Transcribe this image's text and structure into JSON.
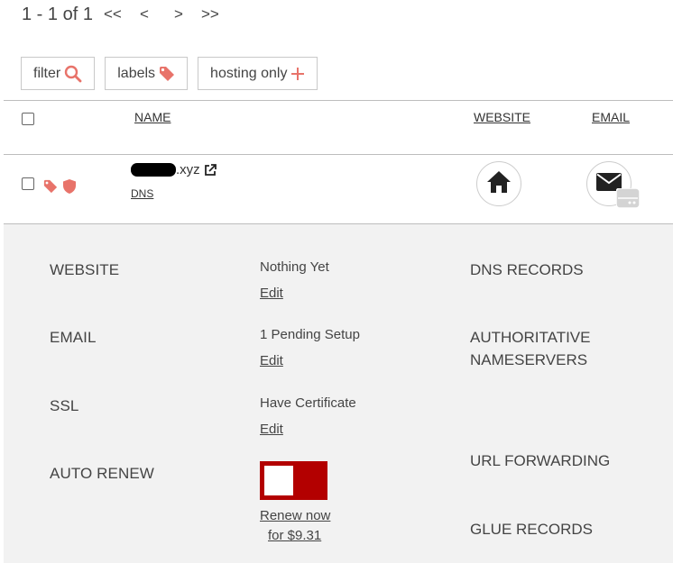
{
  "pager": {
    "count": "1 - 1 of 1",
    "first": "<<",
    "prev": "<",
    "next": ">",
    "last": ">>"
  },
  "chips": {
    "filter": "filter",
    "labels": "labels",
    "hosting_only": "hosting only"
  },
  "table": {
    "col_name": "NAME",
    "col_website": "WEBSITE",
    "col_email": "EMAIL"
  },
  "row": {
    "domain_suffix": ".xyz",
    "dns_link": "DNS"
  },
  "details": {
    "website_label": "WEBSITE",
    "website_value": "Nothing Yet",
    "website_edit": "Edit",
    "email_label": "EMAIL",
    "email_value": "1 Pending Setup",
    "email_edit": "Edit",
    "ssl_label": "SSL",
    "ssl_value": "Have Certificate",
    "ssl_edit": "Edit",
    "autorenew_label": "AUTO RENEW",
    "renew_now": "Renew now",
    "renew_price": "for $9.31",
    "dns_records": "DNS RECORDS",
    "auth_ns_line1": "AUTHORITATIVE",
    "auth_ns_line2": "NAMESERVERS",
    "url_forwarding": "URL FORWARDING",
    "glue_records": "GLUE RECORDS"
  },
  "colors": {
    "accent": "#e8736a",
    "toggle": "#b30000",
    "panel_bg": "#f2f2f2"
  },
  "icons": [
    "search-icon",
    "tag-icon",
    "plus-icon",
    "external-link-icon",
    "shield-icon",
    "home-icon",
    "mail-icon",
    "server-icon"
  ]
}
